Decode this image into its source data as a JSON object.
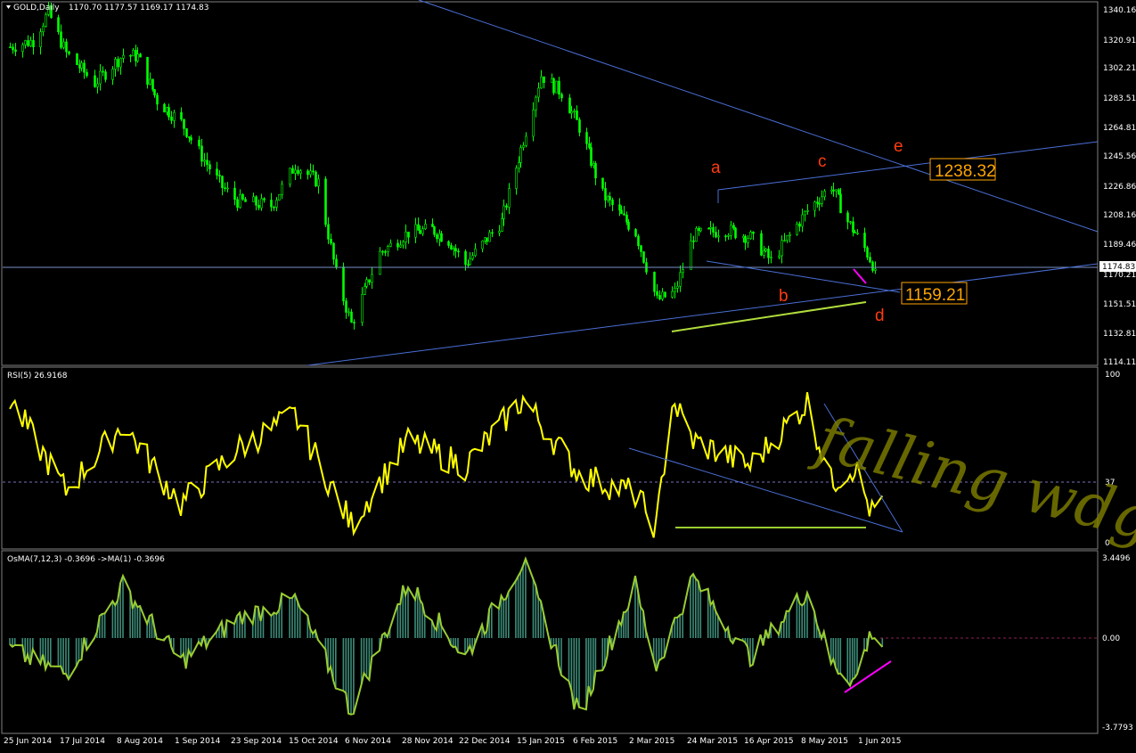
{
  "window": {
    "symbol": "GOLD,Daily",
    "ohlc": "1170.70 1177.57 1169.17 1174.83"
  },
  "price_axis": {
    "ticks": [
      "1340.16",
      "1320.91",
      "1302.21",
      "1283.51",
      "1264.81",
      "1245.56",
      "1226.86",
      "1208.16",
      "1189.46",
      "1170.21",
      "1151.51",
      "1132.81",
      "1114.11"
    ],
    "current": "1174.83"
  },
  "date_axis": [
    "25 Jun 2014",
    "17 Jul 2014",
    "8 Aug 2014",
    "1 Sep 2014",
    "23 Sep 2014",
    "15 Oct 2014",
    "6 Nov 2014",
    "28 Nov 2014",
    "22 Dec 2014",
    "15 Jan 2015",
    "6 Feb 2015",
    "2 Mar 2015",
    "24 Mar 2015",
    "16 Apr 2015",
    "8 May 2015",
    "1 Jun 2015"
  ],
  "rsi": {
    "label": "RSI(5) 26.9168",
    "ticks": [
      "100",
      "37",
      "0"
    ]
  },
  "osma": {
    "label": "OsMA(7,12,3) -0.3696  ->MA(1) -0.3696",
    "ticks": [
      "3.4496",
      "0.00",
      "-3.7793"
    ]
  },
  "annotations": {
    "waves": [
      "a",
      "b",
      "c",
      "d",
      "e"
    ],
    "level_high": "1238.32",
    "level_low": "1159.21",
    "handwriting": "falling wdg"
  },
  "colors": {
    "background": "#000000",
    "candles": "#00ff00",
    "rsi": "#ffff00",
    "osma_hist": "#3c8c78",
    "osma_line": "#9acd32",
    "trendline": "#4a6fd6",
    "wave_label": "#ff3b10",
    "level_box": "#ffa500",
    "handwriting": "#808000",
    "divergence": "#ff00ff",
    "support": "#9acd32"
  },
  "chart_data": [
    {
      "type": "candlestick",
      "title": "GOLD,Daily",
      "x_range": [
        "25 Jun 2014",
        "8 Jun 2015"
      ],
      "ylim": [
        1114.11,
        1344
      ],
      "series": [
        {
          "name": "GOLD",
          "x": [
            "25 Jun 2014",
            "4 Jul 2014",
            "10 Jul 2014",
            "17 Jul 2014",
            "28 Jul 2014",
            "8 Aug 2014",
            "14 Aug 2014",
            "22 Aug 2014",
            "1 Sep 2014",
            "10 Sep 2014",
            "17 Sep 2014",
            "23 Sep 2014",
            "6 Oct 2014",
            "15 Oct 2014",
            "24 Oct 2014",
            "31 Oct 2014",
            "6 Nov 2014",
            "17 Nov 2014",
            "28 Nov 2014",
            "8 Dec 2014",
            "15 Dec 2014",
            "22 Dec 2014",
            "6 Jan 2015",
            "15 Jan 2015",
            "22 Jan 2015",
            "30 Jan 2015",
            "6 Feb 2015",
            "16 Feb 2015",
            "2 Mar 2015",
            "10 Mar 2015",
            "17 Mar 2015",
            "24 Mar 2015",
            "6 Apr 2015",
            "16 Apr 2015",
            "24 Apr 2015",
            "8 May 2015",
            "18 May 2015",
            "25 May 2015",
            "1 Jun 2015",
            "5 Jun 2015"
          ],
          "close": [
            1316,
            1320,
            1338,
            1312,
            1293,
            1311,
            1310,
            1282,
            1268,
            1244,
            1227,
            1218,
            1215,
            1241,
            1230,
            1172,
            1140,
            1185,
            1198,
            1200,
            1193,
            1178,
            1205,
            1257,
            1298,
            1287,
            1265,
            1222,
            1198,
            1155,
            1160,
            1196,
            1200,
            1195,
            1180,
            1212,
            1228,
            1205,
            1188,
            1174.83
          ]
        }
      ]
    },
    {
      "type": "line",
      "title": "RSI(5) 26.9168",
      "ylim": [
        0,
        100
      ],
      "levels": [
        37
      ],
      "series": [
        {
          "name": "RSI(5)",
          "x": [
            "25 Jun 2014",
            "17 Jul 2014",
            "8 Aug 2014",
            "1 Sep 2014",
            "23 Sep 2014",
            "15 Oct 2014",
            "6 Nov 2014",
            "28 Nov 2014",
            "22 Dec 2014",
            "15 Jan 2015",
            "6 Feb 2015",
            "2 Mar 2015",
            "10 Mar 2015",
            "16 Mar 2015",
            "24 Mar 2015",
            "16 Apr 2015",
            "8 May 2015",
            "18 May 2015",
            "28 May 2015",
            "4 Jun 2015",
            "8 Jun 2015"
          ],
          "values": [
            85,
            30,
            70,
            22,
            55,
            75,
            10,
            60,
            45,
            85,
            40,
            28,
            8,
            85,
            60,
            45,
            83,
            35,
            45,
            16,
            27
          ]
        }
      ]
    },
    {
      "type": "bar",
      "title": "OsMA(7,12,3) -0.3696  ->MA(1) -0.3696",
      "ylim": [
        -3.7793,
        3.4496
      ],
      "series": [
        {
          "name": "OsMA(7,12,3)",
          "x": [
            "25 Jun 2014",
            "17 Jul 2014",
            "8 Aug 2014",
            "1 Sep 2014",
            "23 Sep 2014",
            "15 Oct 2014",
            "6 Nov 2014",
            "28 Nov 2014",
            "22 Dec 2014",
            "15 Jan 2015",
            "6 Feb 2015",
            "2 Mar 2015",
            "10 Mar 2015",
            "24 Mar 2015",
            "16 Apr 2015",
            "8 May 2015",
            "18 May 2015",
            "28 May 2015",
            "4 Jun 2015",
            "8 Jun 2015"
          ],
          "values": [
            -0.5,
            -1.5,
            2.2,
            -1.0,
            0.8,
            1.6,
            -3.0,
            2.3,
            -0.8,
            3.2,
            -3.2,
            2.2,
            -1.2,
            2.5,
            -0.8,
            2.0,
            -1.0,
            -1.8,
            0.3,
            -0.37
          ]
        }
      ]
    }
  ]
}
